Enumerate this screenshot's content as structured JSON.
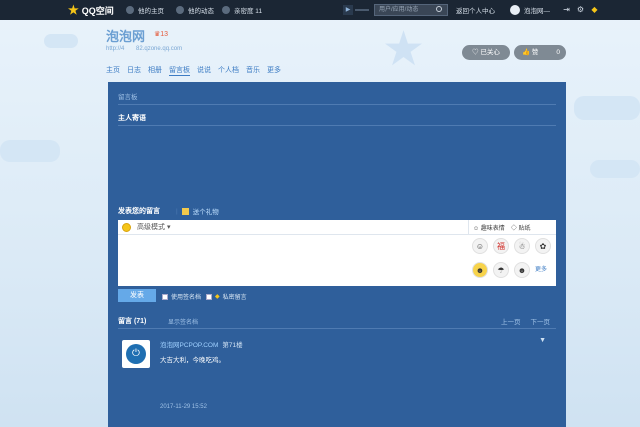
{
  "topbar": {
    "logo": "QQ空间",
    "nav": [
      "他的主页",
      "他的动态",
      "亲密度 11"
    ],
    "search_placeholder": "用户/应用/动态",
    "personal_center": "返回个人中心",
    "user_name": "泡泡网—"
  },
  "header": {
    "site_title": "泡泡网",
    "badge": "13",
    "url_left": "http://4",
    "url_right": "82.qzone.qq.com",
    "nav": [
      "主页",
      "日志",
      "相册",
      "留言板",
      "说说",
      "个人档",
      "音乐",
      "更多"
    ],
    "active_nav_index": 3,
    "follow_label": "已关心",
    "like_label": "赞",
    "like_count": "0"
  },
  "board": {
    "crumb": "留言板",
    "owner_title": "主人寄语",
    "compose_title": "发表您的留言",
    "gift_label": "送个礼物",
    "editor_mode": "高级模式",
    "tab_emoji": "趣味表情",
    "tab_sticker": "贴纸",
    "emojis": [
      "☺",
      "福",
      "☃",
      "✿",
      "☻",
      "☂",
      "☻",
      "✦"
    ],
    "more_label": "更多",
    "send_label": "发表",
    "opt1": "使用签名档",
    "opt2": "私密留言",
    "messages_header": "留言 (71)",
    "show_signature": "显示签名档",
    "prev_page": "上一页",
    "next_page": "下一页"
  },
  "message": {
    "author": "泡泡网PCPOP.COM",
    "floor": "第71楼",
    "text": "大吉大利，今晚吃鸡。",
    "time": "2017-11-29 15:52"
  }
}
